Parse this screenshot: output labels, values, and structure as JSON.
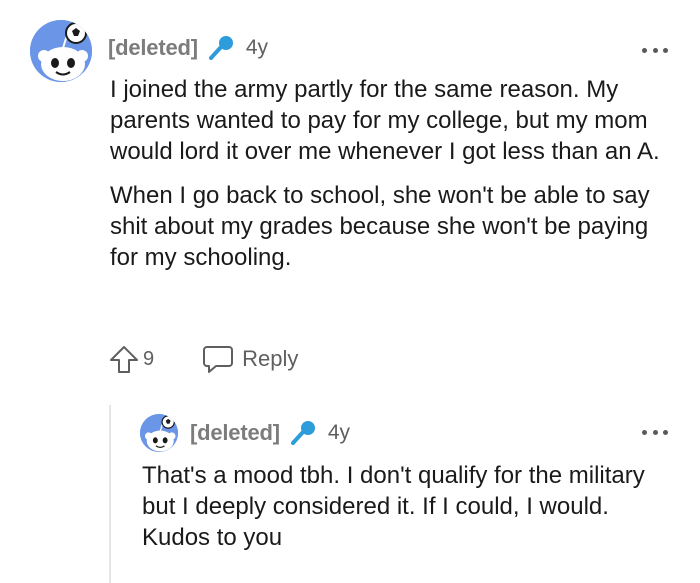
{
  "comment": {
    "author": "[deleted]",
    "age": "4y",
    "paragraphs": [
      "I joined the army partly for the same reason. My parents wanted to pay for my college, but my mom would lord it over me whenever I got less than an A.",
      "When I go back to school, she won't be able to say shit about my grades because she won't be paying for my schooling."
    ],
    "score": "9",
    "reply_label": "Reply"
  },
  "reply": {
    "author": "[deleted]",
    "age": "4y",
    "text": "That's a mood tbh. I don't qualify for the military but I deeply considered it. If I could, I would. Kudos to you"
  },
  "icons": {
    "avatar": "snoo-avatar-icon",
    "award": "microphone-icon",
    "more": "more-options-icon",
    "upvote": "upvote-arrow-icon",
    "reply": "reply-bubble-icon"
  },
  "colors": {
    "avatar_bg": "#6b96e8",
    "mic_blue": "#2d9cdb",
    "meta_gray": "#7c7c7c",
    "thread_line": "#e6e6e6"
  }
}
